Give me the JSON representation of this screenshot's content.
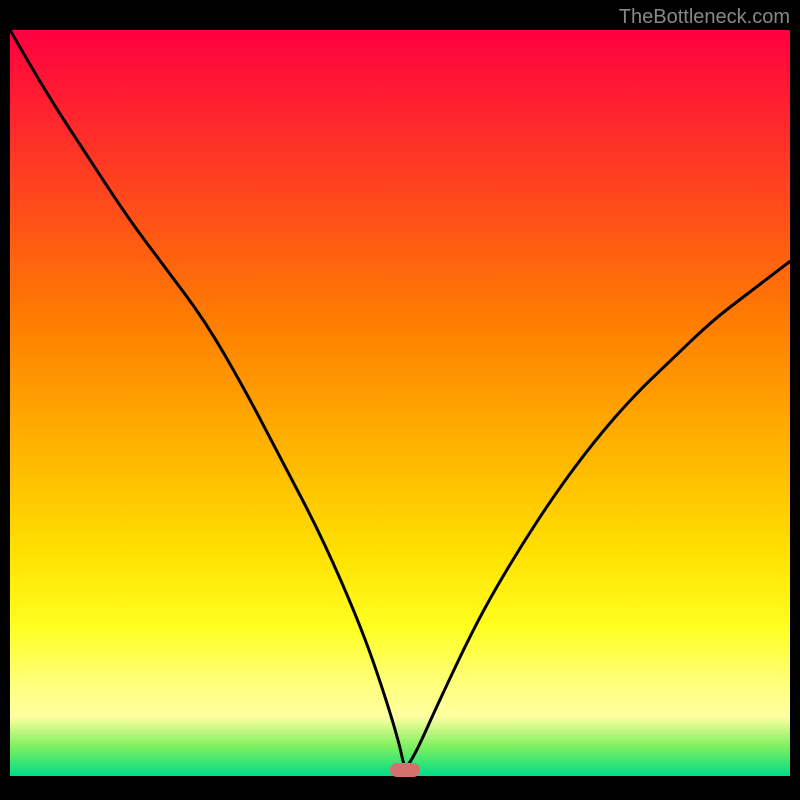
{
  "watermark": "TheBottleneck.com",
  "marker": {
    "x_frac": 0.506,
    "y_frac": 0.992,
    "color": "#d6706f"
  },
  "chart_data": {
    "type": "line",
    "title": "",
    "xlabel": "",
    "ylabel": "",
    "xlim": [
      0,
      1
    ],
    "ylim": [
      0,
      1
    ],
    "background_gradient": {
      "top": "#ff0040",
      "middle": "#ffe000",
      "bottom": "#00dd88"
    },
    "annotations": [
      {
        "text": "TheBottleneck.com",
        "position": "top-right"
      }
    ],
    "series": [
      {
        "name": "curve",
        "color": "#000000",
        "x": [
          0.0,
          0.05,
          0.1,
          0.15,
          0.2,
          0.25,
          0.3,
          0.35,
          0.4,
          0.45,
          0.48,
          0.5,
          0.506,
          0.52,
          0.55,
          0.6,
          0.65,
          0.7,
          0.75,
          0.8,
          0.85,
          0.9,
          0.95,
          1.0
        ],
        "y": [
          1.0,
          0.91,
          0.83,
          0.75,
          0.68,
          0.61,
          0.52,
          0.42,
          0.32,
          0.2,
          0.11,
          0.04,
          0.008,
          0.03,
          0.1,
          0.21,
          0.3,
          0.38,
          0.45,
          0.51,
          0.56,
          0.61,
          0.65,
          0.69
        ]
      }
    ],
    "marker_point": {
      "x": 0.506,
      "y": 0.008
    }
  }
}
